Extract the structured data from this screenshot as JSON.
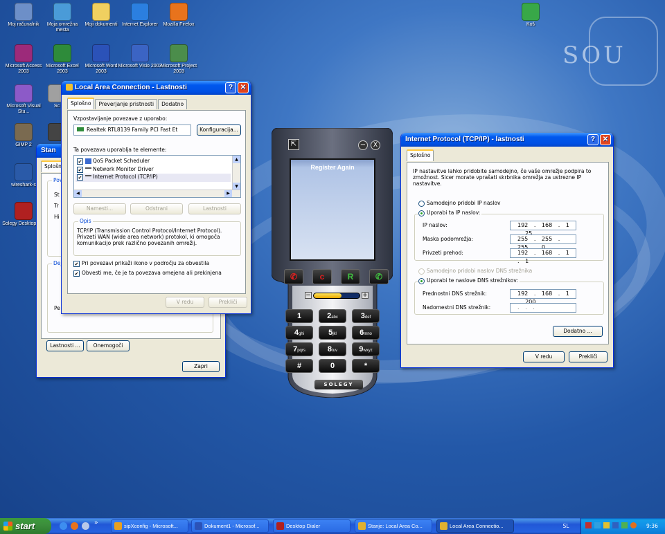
{
  "desktop": {
    "icons": [
      {
        "label": "Moj računalnik",
        "color": "#6d8fc8"
      },
      {
        "label": "Moja omrežna mesta",
        "color": "#4a9bd8"
      },
      {
        "label": "Moji dokumenti",
        "color": "#f0d060"
      },
      {
        "label": "Internet Explorer",
        "color": "#2b7fe0"
      },
      {
        "label": "Mozilla Firefox",
        "color": "#e8731c"
      },
      {
        "label": "Microsoft Access 2003",
        "color": "#9c2a7a"
      },
      {
        "label": "Microsoft Excel 2003",
        "color": "#2e8b3a"
      },
      {
        "label": "Microsoft Word 2003",
        "color": "#2b52b8"
      },
      {
        "label": "Microsoft Visio 2003",
        "color": "#3b64c4"
      },
      {
        "label": "Microsoft Project 2003",
        "color": "#4b8d4b"
      },
      {
        "label": "Microsoft Visual Stu...",
        "color": "#8c5ac8"
      },
      {
        "label": "Sc",
        "color": "#a0a0a0"
      },
      {
        "label": "GIMP 2",
        "color": "#7a6a50"
      },
      {
        "label": "",
        "color": "#444444"
      },
      {
        "label": "wireshark-s",
        "color": "#2a5aa8"
      },
      {
        "label": "Solegy Desktop Dia",
        "color": "#b02020"
      },
      {
        "label": "Koš",
        "color": "#38a848"
      }
    ]
  },
  "bg_window": {
    "title": "Stan",
    "tab": "Splošn",
    "group1": "Pov",
    "row_labels": [
      "St",
      "Tr",
      "Hi"
    ],
    "group2": "Dej",
    "pe_label": "Pe",
    "properties_button": "Lastnosti ...",
    "disable_button": "Onemogoči",
    "close_button": "Zapri"
  },
  "lan_window": {
    "title": "Local Area Connection - Lastnosti",
    "tabs": [
      "Splošno",
      "Preverjanje pristnosti",
      "Dodatno"
    ],
    "connect_using_label": "Vzpostavljanje povezave z uporabo:",
    "adapter_name": "Realtek RTL8139 Family PCI Fast Et",
    "configure_button": "Konfiguracija...",
    "items_label": "Ta povezava uporablja te elemente:",
    "items": [
      "QoS Packet Scheduler",
      "Network Monitor Driver",
      "Internet Protocol (TCP/IP)"
    ],
    "install_button": "Namesti...",
    "uninstall_button": "Odstrani",
    "properties_button": "Lastnosti",
    "desc_title": "Opis",
    "description": "TCP/IP (Transmission Control Protocol/Internet Protocol). Privzeti WAN (wide area network) protokol, ki omogoča komunikacijo prek različno povezanih omrežij.",
    "check_show_icon": "Pri povezavi prikaži ikono v področju za obvestila",
    "check_notify": "Obvesti me, če je ta povezava omejena ali prekinjena",
    "ok_button": "V redu",
    "cancel_button": "Prekliči"
  },
  "phone": {
    "register_text": "Register Again",
    "minimize_icon": "minus-icon",
    "close_glyph": "X",
    "func_keys": [
      "c",
      "R"
    ],
    "keys": [
      {
        "main": "1",
        "sub": ""
      },
      {
        "main": "2",
        "sub": "abc"
      },
      {
        "main": "3",
        "sub": "def"
      },
      {
        "main": "4",
        "sub": "ghi"
      },
      {
        "main": "5",
        "sub": "jkl"
      },
      {
        "main": "6",
        "sub": "mno"
      },
      {
        "main": "7",
        "sub": "pqrs"
      },
      {
        "main": "8",
        "sub": "tuv"
      },
      {
        "main": "9",
        "sub": "wxyz"
      },
      {
        "main": "#",
        "sub": ""
      },
      {
        "main": "0",
        "sub": ""
      },
      {
        "main": "*",
        "sub": ""
      }
    ],
    "brand": "SOLEGY",
    "volume_level": 0.6
  },
  "tcp_window": {
    "title": "Internet Protocol (TCP/IP) - lastnosti",
    "tab": "Splošno",
    "intro": "IP nastavitve lahko pridobite samodejno, če vaše omrežje podpira to zmožnost. Sicer morate vprašati skrbnika omrežja za ustrezne IP nastavitve.",
    "radio_auto_ip": "Samodejno pridobi IP naslov",
    "radio_manual_ip": "Uporabi ta IP naslov:",
    "ip_label": "IP naslov:",
    "ip_value": "192 . 168 . 1 . 25",
    "mask_label": "Maska podomrežja:",
    "mask_value": "255 . 255 . 255 . 0",
    "gateway_label": "Privzeti prehod:",
    "gateway_value": "192 . 168 . 1 . 1",
    "radio_auto_dns": "Samodejno pridobi naslov DNS strežnika",
    "radio_manual_dns": "Uporabi te naslove DNS strežnikov:",
    "pref_dns_label": "Prednostni DNS strežnik:",
    "pref_dns_value": "192 . 168 . 1 . 200",
    "alt_dns_label": "Nadomestni DNS strežnik:",
    "alt_dns_value": ". . .",
    "advanced_button": "Dodatno ...",
    "ok_button": "V redu",
    "cancel_button": "Prekliči"
  },
  "taskbar": {
    "start_label": "start",
    "overflow": "»",
    "items": [
      {
        "label": "sipXconfig - Microsoft...",
        "color": "#e8a020"
      },
      {
        "label": "Dokument1 - Microsof...",
        "color": "#2b52b8"
      },
      {
        "label": "Desktop Dialer",
        "color": "#b02020"
      },
      {
        "label": "Stanje: Local Area Co...",
        "color": "#e0b030"
      },
      {
        "label": "Local Area Connectio...",
        "color": "#e0b030"
      }
    ],
    "language": "SL",
    "clock": "9:36"
  }
}
